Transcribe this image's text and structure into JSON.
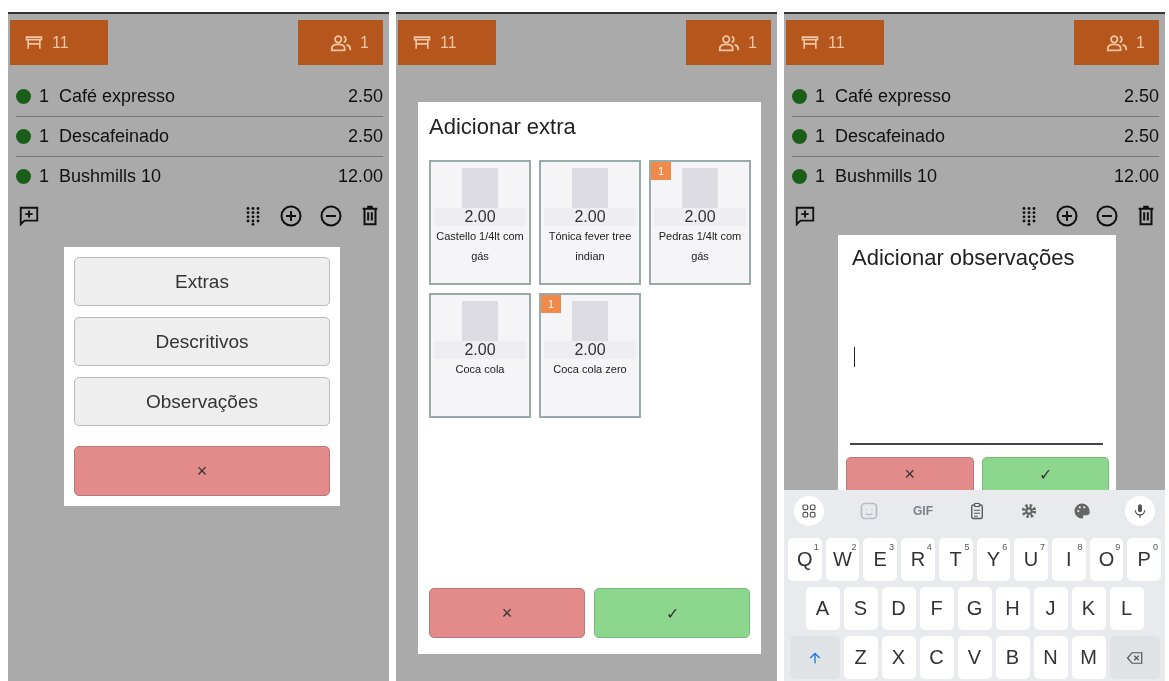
{
  "panels": [
    {
      "kind": "options",
      "table": "11",
      "guests": "1",
      "items": [
        {
          "qty": "1",
          "name": "Café expresso",
          "price": "2.50"
        },
        {
          "qty": "1",
          "name": "Descafeinado",
          "price": "2.50"
        },
        {
          "qty": "1",
          "name": "Bushmills 10",
          "price": "12.00"
        }
      ],
      "menu": {
        "options": [
          "Extras",
          "Descritivos",
          "Observações"
        ],
        "cancel": "×"
      }
    },
    {
      "kind": "extras",
      "table": "11",
      "guests": "1",
      "dialog": {
        "title": "Adicionar extra",
        "products": [
          {
            "price": "2.00",
            "name": "Castello 1/4lt com gás"
          },
          {
            "price": "2.00",
            "name": "Tónica fever tree indian"
          },
          {
            "price": "2.00",
            "name": "Pedras 1/4lt com gás",
            "badge": "1"
          },
          {
            "price": "2.00",
            "name": "Coca cola"
          },
          {
            "price": "2.00",
            "name": "Coca cola zero",
            "badge": "1"
          }
        ],
        "cancel": "×",
        "confirm": "✓"
      }
    },
    {
      "kind": "notes",
      "table": "11",
      "guests": "1",
      "items": [
        {
          "qty": "1",
          "name": "Café expresso",
          "price": "2.50"
        },
        {
          "qty": "1",
          "name": "Descafeinado",
          "price": "2.50"
        },
        {
          "qty": "1",
          "name": "Bushmills 10",
          "price": "12.00"
        }
      ],
      "dialog": {
        "title": "Adicionar observações",
        "cancel": "×",
        "confirm": "✓"
      },
      "keyboard": {
        "gif": "GIF",
        "rows": [
          [
            {
              "key": "Q",
              "hint": "1"
            },
            {
              "key": "W",
              "hint": "2"
            },
            {
              "key": "E",
              "hint": "3"
            },
            {
              "key": "R",
              "hint": "4"
            },
            {
              "key": "T",
              "hint": "5"
            },
            {
              "key": "Y",
              "hint": "6"
            },
            {
              "key": "U",
              "hint": "7"
            },
            {
              "key": "I",
              "hint": "8"
            },
            {
              "key": "O",
              "hint": "9"
            },
            {
              "key": "P",
              "hint": "0"
            }
          ],
          [
            {
              "key": "A"
            },
            {
              "key": "S"
            },
            {
              "key": "D"
            },
            {
              "key": "F"
            },
            {
              "key": "G"
            },
            {
              "key": "H"
            },
            {
              "key": "J"
            },
            {
              "key": "K"
            },
            {
              "key": "L"
            }
          ],
          [
            {
              "key": "Z"
            },
            {
              "key": "X"
            },
            {
              "key": "C"
            },
            {
              "key": "V"
            },
            {
              "key": "B"
            },
            {
              "key": "N"
            },
            {
              "key": "M"
            }
          ]
        ]
      }
    }
  ]
}
